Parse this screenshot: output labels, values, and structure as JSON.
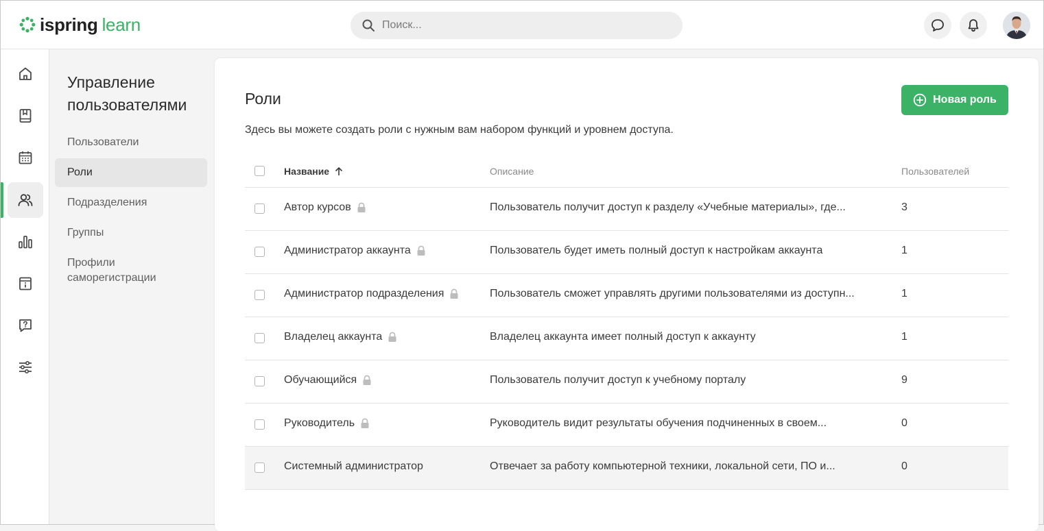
{
  "app": {
    "logo_primary": "ispring",
    "logo_secondary": "learn",
    "brand_color": "#3bb266"
  },
  "header": {
    "search_placeholder": "Поиск...",
    "icons": [
      "search-icon",
      "chat-icon",
      "bell-icon",
      "user-avatar"
    ]
  },
  "rail": {
    "items": [
      {
        "icon": "home-icon"
      },
      {
        "icon": "book-icon"
      },
      {
        "icon": "calendar-icon"
      },
      {
        "icon": "users-icon",
        "active": true
      },
      {
        "icon": "bar-chart-icon"
      },
      {
        "icon": "info-board-icon"
      },
      {
        "icon": "question-chat-icon"
      },
      {
        "icon": "sliders-icon"
      }
    ]
  },
  "subnav": {
    "title": "Управление пользователями",
    "items": [
      {
        "label": "Пользователи"
      },
      {
        "label": "Роли",
        "active": true
      },
      {
        "label": "Подразделения"
      },
      {
        "label": "Группы"
      },
      {
        "label": "Профили саморегистрации"
      }
    ]
  },
  "main": {
    "title": "Роли",
    "description": "Здесь вы можете создать роли с нужным вам набором функций и уровнем доступа.",
    "new_button": "Новая роль",
    "columns": {
      "name": "Название",
      "description": "Описание",
      "users": "Пользователей"
    },
    "rows": [
      {
        "name": "Автор курсов",
        "locked": true,
        "description": "Пользователь получит доступ к разделу «Учебные материалы», где...",
        "users": "3"
      },
      {
        "name": "Администратор аккаунта",
        "locked": true,
        "description": "Пользователь будет иметь полный доступ к настройкам аккаунта",
        "users": "1"
      },
      {
        "name": "Администратор подразделения",
        "locked": true,
        "description": "Пользователь сможет управлять другими пользователями из доступн...",
        "users": "1"
      },
      {
        "name": "Владелец аккаунта",
        "locked": true,
        "description": "Владелец аккаунта имеет полный доступ к аккаунту",
        "users": "1"
      },
      {
        "name": "Обучающийся",
        "locked": true,
        "description": "Пользователь получит доступ к учебному порталу",
        "users": "9"
      },
      {
        "name": "Руководитель",
        "locked": true,
        "description": "Руководитель видит результаты обучения подчиненных в своем...",
        "users": "0"
      },
      {
        "name": "Системный администратор",
        "locked": false,
        "description": "Отвечает за работу компьютерной техники, локальной сети, ПО и...",
        "users": "0"
      }
    ]
  }
}
